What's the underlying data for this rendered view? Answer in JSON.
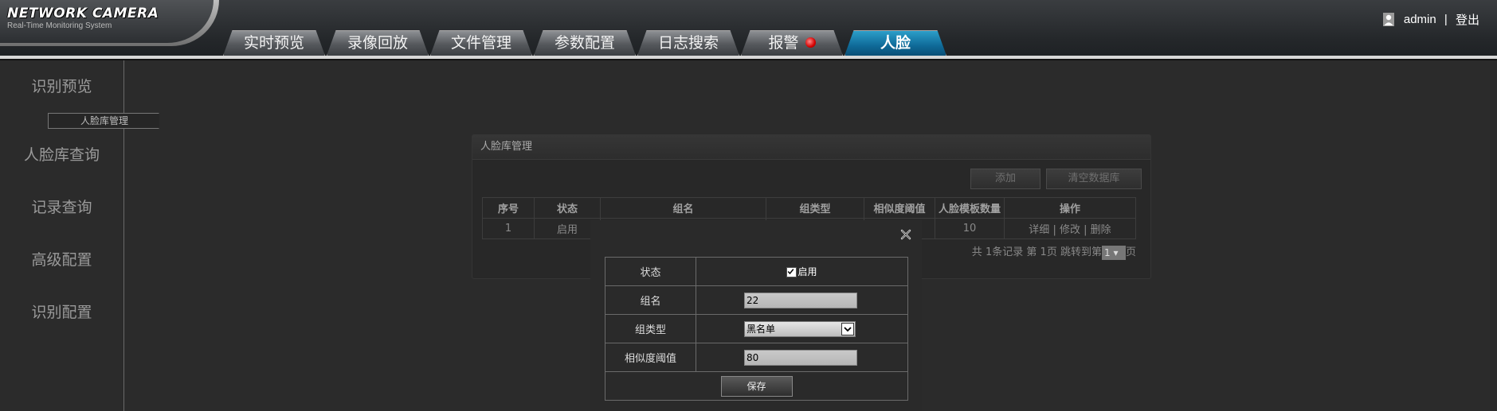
{
  "logo": {
    "title": "NETWORK CAMERA",
    "subtitle": "Real-Time Monitoring System"
  },
  "tabs": [
    {
      "label": "实时预览"
    },
    {
      "label": "录像回放"
    },
    {
      "label": "文件管理"
    },
    {
      "label": "参数配置"
    },
    {
      "label": "日志搜索"
    },
    {
      "label": "报警"
    },
    {
      "label": "人脸",
      "active": true
    }
  ],
  "user": {
    "name": "admin",
    "separator": "|",
    "logout": "登出"
  },
  "sidebar": {
    "items": [
      {
        "label": "识别预览"
      },
      {
        "label": "人脸库管理",
        "selected": true
      },
      {
        "label": "人脸库查询"
      },
      {
        "label": "记录查询"
      },
      {
        "label": "高级配置"
      },
      {
        "label": "识别配置"
      }
    ]
  },
  "panel": {
    "title": "人脸库管理",
    "add_label": "添加",
    "clear_label": "清空数据库",
    "columns": [
      "序号",
      "状态",
      "组名",
      "组类型",
      "相似度阈值",
      "人脸模板数量",
      "操作"
    ],
    "rows": [
      {
        "index": "1",
        "status": "启用",
        "template_count": "10",
        "actions": [
          "详细",
          "修改",
          "删除"
        ]
      }
    ],
    "action_separator": "|",
    "pager": {
      "text1": "共",
      "total": "1",
      "text2": "条记录",
      "text3": "第",
      "page": "1",
      "text4": "页",
      "jump_label": "跳转到第",
      "jump_value": "1",
      "text5": "页"
    }
  },
  "modal": {
    "fields": {
      "status_label": "状态",
      "status_checkbox_label": "启用",
      "status_checked": true,
      "group_name_label": "组名",
      "group_name_value": "22",
      "group_type_label": "组类型",
      "group_type_value": "黑名单",
      "threshold_label": "相似度阈值",
      "threshold_value": "80"
    },
    "save_label": "保存"
  },
  "colors": {
    "active_tab": "#1477a8",
    "alarm": "#d40000"
  }
}
